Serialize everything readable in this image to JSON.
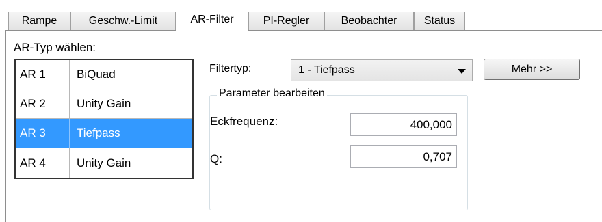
{
  "tabs": [
    {
      "label": "Rampe",
      "active": false
    },
    {
      "label": "Geschw.-Limit",
      "active": false
    },
    {
      "label": "AR-Filter",
      "active": true
    },
    {
      "label": "PI-Regler",
      "active": false
    },
    {
      "label": "Beobachter",
      "active": false
    },
    {
      "label": "Status",
      "active": false
    }
  ],
  "ar_type_label": "AR-Typ wählen:",
  "ar_list": [
    {
      "id": "AR 1",
      "name": "BiQuad",
      "selected": false
    },
    {
      "id": "AR 2",
      "name": "Unity Gain",
      "selected": false
    },
    {
      "id": "AR 3",
      "name": "Tiefpass",
      "selected": true
    },
    {
      "id": "AR 4",
      "name": "Unity Gain",
      "selected": false
    }
  ],
  "filter_type": {
    "label": "Filtertyp:",
    "value": "1 - Tiefpass"
  },
  "more_button": "Mehr >>",
  "params": {
    "title": "Parameter bearbeiten",
    "cutoff_label": "Eckfrequenz:",
    "cutoff_value": "400,000",
    "q_label": "Q:",
    "q_value": "0,707"
  },
  "colors": {
    "selection": "#3399ff"
  }
}
